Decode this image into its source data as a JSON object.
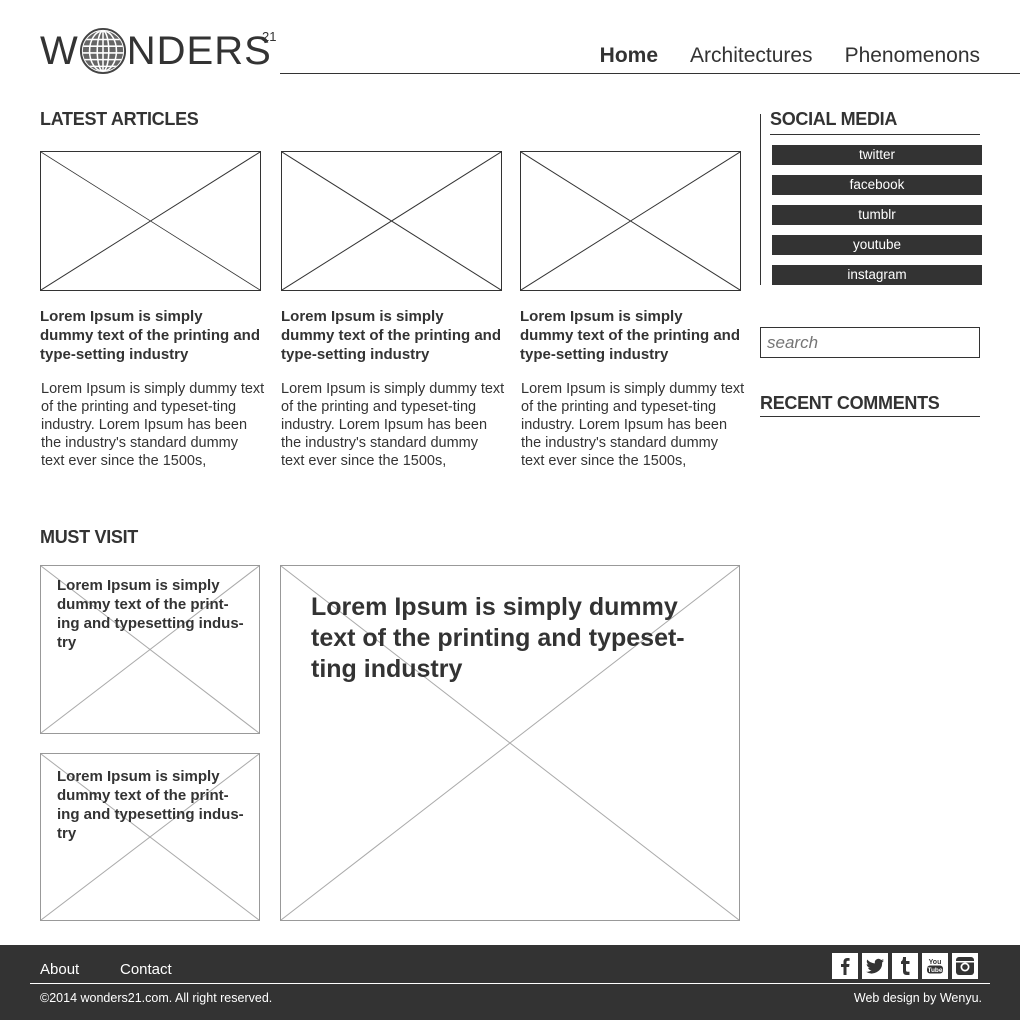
{
  "header": {
    "logo_text_left": "W",
    "logo_text_right": "NDERS",
    "logo_sup": "21",
    "logo_icon": "globe-icon",
    "nav": [
      {
        "label": "Home",
        "active": true
      },
      {
        "label": "Architectures",
        "active": false
      },
      {
        "label": "Phenomenons",
        "active": false
      }
    ]
  },
  "latest": {
    "heading": "LATEST ARTICLES",
    "articles": [
      {
        "title": "Lorem Ipsum is simply dummy text of the printing and type-setting industry",
        "body": "Lorem Ipsum is simply dummy text of the printing and typeset-ting industry. Lorem Ipsum has been the industry's standard dummy text ever since the 1500s,"
      },
      {
        "title": "Lorem Ipsum is simply dummy text of the printing and type-setting industry",
        "body": "Lorem Ipsum is simply dummy text of the printing and typeset-ting industry. Lorem Ipsum has been the industry's standard dummy text ever since the 1500s,"
      },
      {
        "title": "Lorem Ipsum is simply dummy text of the printing and type-setting industry",
        "body": "Lorem Ipsum is simply dummy text of the printing and typeset-ting industry. Lorem Ipsum has been the industry's standard dummy text ever since the 1500s,"
      }
    ]
  },
  "sidebar": {
    "social_heading": "SOCIAL MEDIA",
    "social": [
      "twitter",
      "facebook",
      "tumblr",
      "youtube",
      "instagram"
    ],
    "search_placeholder": "search",
    "recent_heading": "RECENT COMMENTS"
  },
  "must_visit": {
    "heading": "MUST VISIT",
    "small": [
      "Lorem Ipsum is simply dummy text of the print-ing and typesetting indus-try",
      "Lorem Ipsum is simply dummy text of the print-ing and typesetting indus-try"
    ],
    "large": "Lorem Ipsum is simply dummy text of the printing and typeset-ting industry"
  },
  "footer": {
    "links": [
      "About",
      "Contact"
    ],
    "copyright": "©2014 wonders21.com. All right reserved.",
    "credit": "Web  design by Wenyu.",
    "icons": [
      {
        "name": "facebook-icon",
        "glyph": "f"
      },
      {
        "name": "twitter-icon",
        "glyph": "🐦"
      },
      {
        "name": "tumblr-icon",
        "glyph": "t"
      },
      {
        "name": "youtube-icon",
        "glyph": "You Tube"
      },
      {
        "name": "instagram-icon",
        "glyph": "◙"
      }
    ]
  }
}
